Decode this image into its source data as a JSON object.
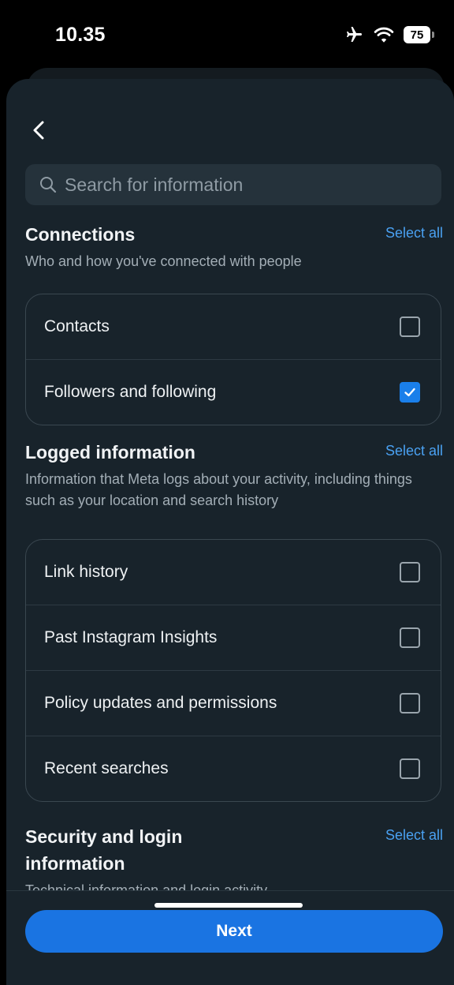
{
  "status_bar": {
    "time": "10.35",
    "battery": "75"
  },
  "icons": {
    "back": "chevron-left-icon",
    "search": "search-icon",
    "airplane": "airplane-icon",
    "wifi": "wifi-icon",
    "battery": "battery-icon",
    "check": "check-icon"
  },
  "search": {
    "placeholder": "Search for information"
  },
  "sections": [
    {
      "title": "Connections",
      "subtitle": "Who and how you've connected with people",
      "select_all": "Select all",
      "items": [
        {
          "label": "Contacts",
          "checked": false
        },
        {
          "label": "Followers and following",
          "checked": true
        }
      ]
    },
    {
      "title": "Logged information",
      "subtitle": "Information that Meta logs about your activity, including things such as your location and search history",
      "select_all": "Select all",
      "items": [
        {
          "label": "Link history",
          "checked": false
        },
        {
          "label": "Past Instagram Insights",
          "checked": false
        },
        {
          "label": "Policy updates and permissions",
          "checked": false
        },
        {
          "label": "Recent searches",
          "checked": false
        }
      ]
    },
    {
      "title": "Security and login information",
      "subtitle": "Technical information and login activity",
      "select_all": "Select all"
    }
  ],
  "footer": {
    "next_label": "Next"
  },
  "colors": {
    "accent": "#1a74e2",
    "link": "#4aa1f2",
    "background": "#18232b"
  }
}
